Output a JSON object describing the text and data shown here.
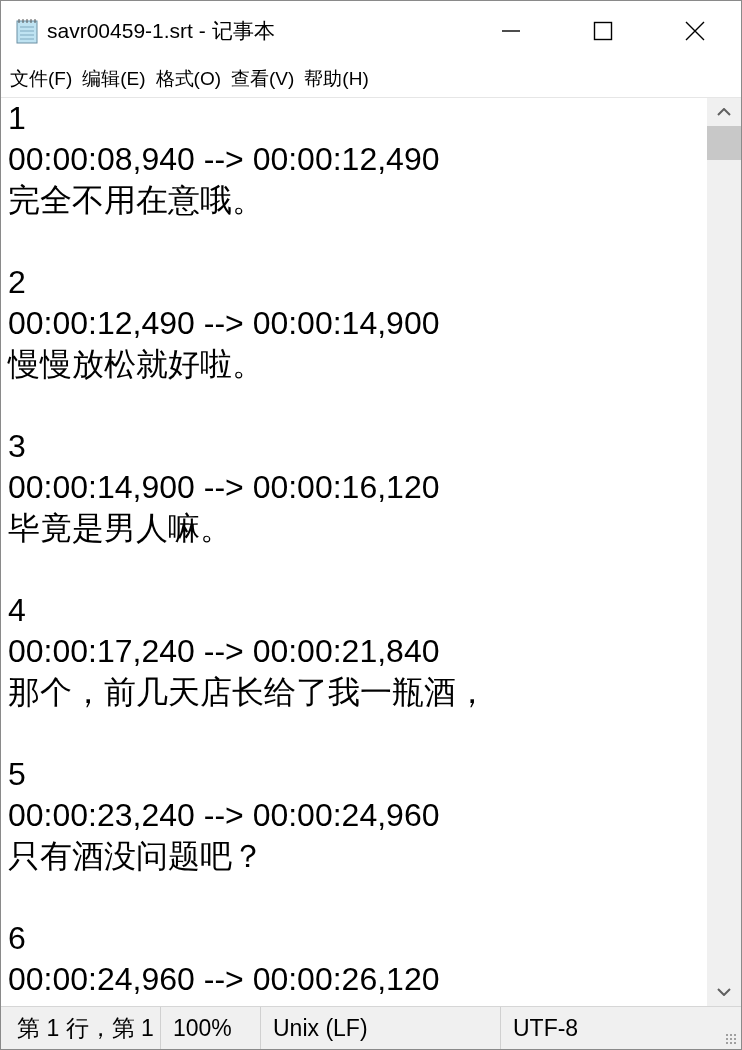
{
  "window": {
    "title": "savr00459-1.srt - 记事本"
  },
  "menu": [
    "文件(F)",
    "编辑(E)",
    "格式(O)",
    "查看(V)",
    "帮助(H)"
  ],
  "entries": [
    {
      "index": "1",
      "timing": "00:00:08,940 --> 00:00:12,490",
      "text": "完全不用在意哦。"
    },
    {
      "index": "2",
      "timing": "00:00:12,490 --> 00:00:14,900",
      "text": "慢慢放松就好啦。"
    },
    {
      "index": "3",
      "timing": "00:00:14,900 --> 00:00:16,120",
      "text": "毕竟是男人嘛。"
    },
    {
      "index": "4",
      "timing": "00:00:17,240 --> 00:00:21,840",
      "text": "那个，前几天店长给了我一瓶酒，"
    },
    {
      "index": "5",
      "timing": "00:00:23,240 --> 00:00:24,960",
      "text": "只有酒没问题吧？"
    },
    {
      "index": "6",
      "timing": "00:00:24,960 --> 00:00:26,120"
    }
  ],
  "status_bar": [
    "第 1 行，第 1",
    "100%",
    "Unix (LF)",
    "UTF-8"
  ]
}
